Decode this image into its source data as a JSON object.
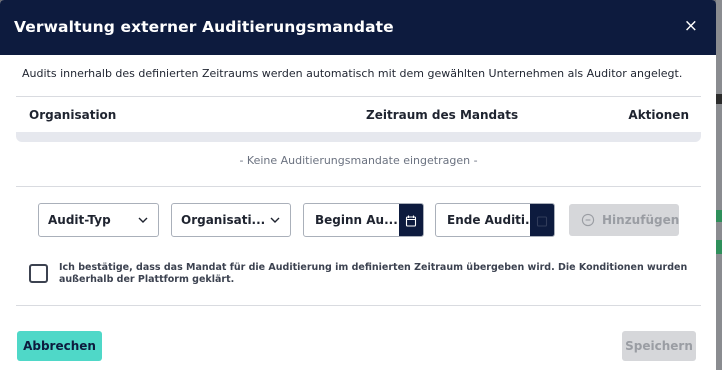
{
  "modal": {
    "title": "Verwaltung externer Auditierungsmandate",
    "close_label": "×",
    "intro": "Audits innerhalb des definierten Zeitraums werden automatisch mit dem gewählten Unternehmen als Auditor angelegt."
  },
  "table": {
    "headers": [
      "Organisation",
      "Zeitraum des Mandats",
      "Aktionen"
    ],
    "empty_message": "- Keine Auditierungsmandate eingetragen -"
  },
  "form": {
    "audit_type": {
      "label": "Audit-Typ",
      "icon": "chevron-down-icon"
    },
    "organisation": {
      "label": "Organisati...",
      "icon": "chevron-down-icon"
    },
    "begin_date": {
      "label": "Beginn Au...",
      "icon": "calendar-icon"
    },
    "end_date": {
      "label": "Ende Auditi...",
      "icon": "calendar-icon"
    },
    "add_button": {
      "label": "Hinzufügen",
      "icon": "plus-circle-icon",
      "disabled": true
    }
  },
  "confirmation": {
    "text": "Ich bestätige, dass das Mandat für die Auditierung im definierten Zeitraum übergeben wird. Die Konditionen wurden außerhalb der Plattform geklärt.",
    "checked": false
  },
  "footer": {
    "cancel_label": "Abbrechen",
    "save_label": "Speichern",
    "save_disabled": true
  },
  "colors": {
    "header_bg": "#0d1b3e",
    "accent": "#4fd8c8",
    "disabled_bg": "#d6d7da"
  }
}
